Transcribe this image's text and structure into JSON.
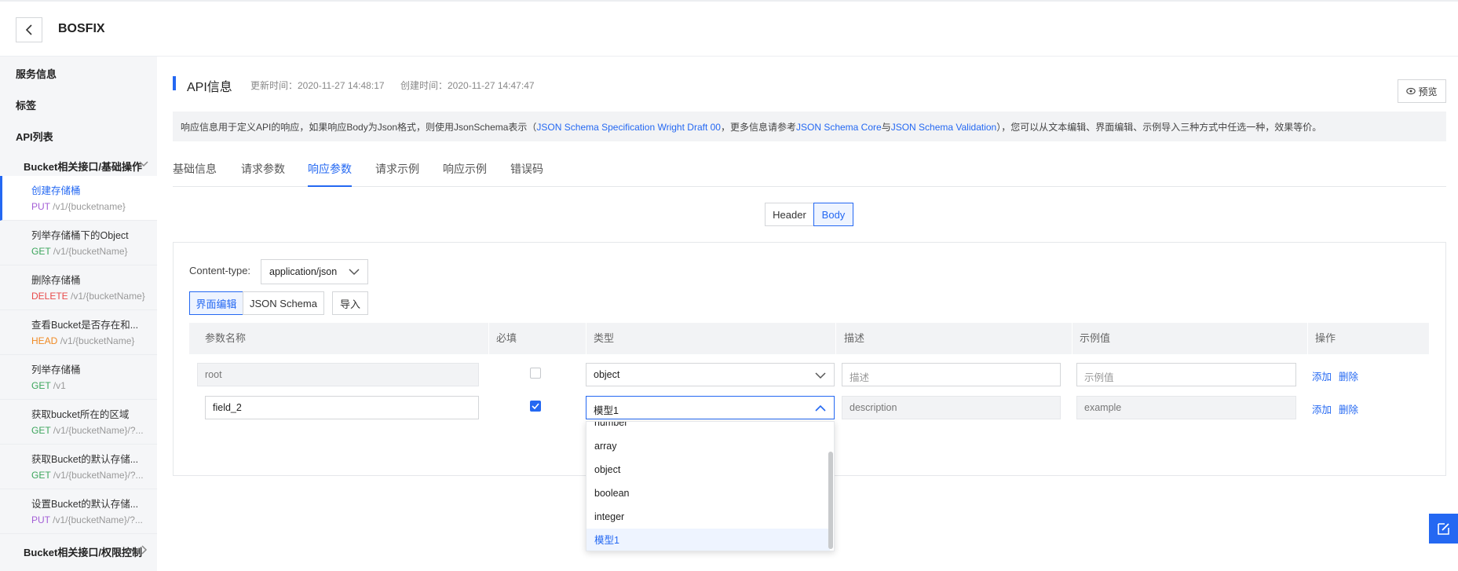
{
  "header": {
    "title": "BOSFIX"
  },
  "sidebar": {
    "sections": [
      "服务信息",
      "标签",
      "API列表"
    ],
    "groups": [
      {
        "label": "Bucket相关接口/基础操作"
      },
      {
        "label": "Bucket相关接口/权限控制"
      }
    ],
    "items": [
      {
        "name": "创建存储桶",
        "method": "PUT",
        "path": "/v1/{bucketname}"
      },
      {
        "name": "列举存储桶下的Object",
        "method": "GET",
        "path": "/v1/{bucketName}"
      },
      {
        "name": "删除存储桶",
        "method": "DELETE",
        "path": "/v1/{bucketName}"
      },
      {
        "name": "查看Bucket是否存在和...",
        "method": "HEAD",
        "path": "/v1/{bucketName}"
      },
      {
        "name": "列举存储桶",
        "method": "GET",
        "path": "/v1"
      },
      {
        "name": "获取bucket所在的区域",
        "method": "GET",
        "path": "/v1/{bucketName}/?..."
      },
      {
        "name": "获取Bucket的默认存储...",
        "method": "GET",
        "path": "/v1/{bucketName}/?..."
      },
      {
        "name": "设置Bucket的默认存储...",
        "method": "PUT",
        "path": "/v1/{bucketName}/?..."
      }
    ]
  },
  "main": {
    "title": "API信息",
    "updated": "更新时间：2020-11-27 14:48:17",
    "created": "创建时间：2020-11-27 14:47:47",
    "preview_label": "预览",
    "notice": {
      "p1": "响应信息用于定义API的响应，如果响应Body为Json格式，则使用JsonSchema表示（",
      "link1": "JSON Schema Specification Wright Draft 00",
      "p2": "，更多信息请参考",
      "link2": "JSON Schema Core",
      "p3": "与",
      "link3": "JSON Schema Validation",
      "p4": "），您可以从文本编辑、界面编辑、示例导入三种方式中任选一种，效果等价。"
    },
    "tabs": [
      "基础信息",
      "请求参数",
      "响应参数",
      "请求示例",
      "响应示例",
      "错误码"
    ],
    "seg": {
      "header": "Header",
      "body": "Body"
    },
    "content_type_label": "Content-type:",
    "content_type_value": "application/json",
    "modes": {
      "ui": "界面编辑",
      "json": "JSON Schema",
      "import": "导入"
    },
    "columns": [
      "参数名称",
      "必填",
      "类型",
      "描述",
      "示例值",
      "操作"
    ],
    "rows": [
      {
        "name": "root",
        "type": "object",
        "desc_placeholder": "描述",
        "example_placeholder": "示例值",
        "add": "添加",
        "delete": "删除"
      },
      {
        "name": "field_2",
        "type": "模型1",
        "desc_placeholder": "description",
        "example_placeholder": "example",
        "add": "添加",
        "delete": "删除"
      }
    ],
    "dropdown_options": [
      "number",
      "array",
      "object",
      "boolean",
      "integer",
      "模型1"
    ]
  },
  "icons": {
    "back": "chevron-left-icon",
    "preview": "eye-icon",
    "fab": "edit-icon"
  },
  "colors": {
    "accent": "#2468f2",
    "put": "#a35ed6",
    "get": "#3ca55c",
    "delete": "#e84a4a",
    "head": "#f08a24"
  }
}
